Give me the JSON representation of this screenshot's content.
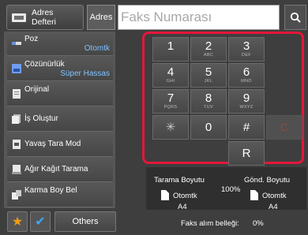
{
  "header": {
    "address_book_label_line1": "Adres",
    "address_book_label_line2": "Defteri",
    "address_label": "Adres",
    "fax_placeholder": "Faks Numarası",
    "search_icon": "search-icon"
  },
  "menu": {
    "items": [
      {
        "label": "Poz",
        "value": "Otomtk",
        "icon": "exposure-icon"
      },
      {
        "label": "Çözünürlük",
        "value": "Süper Hassas",
        "icon": "resolution-icon"
      },
      {
        "label": "Orijinal",
        "value": "",
        "icon": "original-icon"
      },
      {
        "label": "İş Oluştur",
        "value": "",
        "icon": "job-build-icon"
      },
      {
        "label": "Yavaş Tara Mod",
        "value": "",
        "icon": "slow-scan-icon"
      },
      {
        "label": "Ağır Kağıt Tarama",
        "value": "",
        "icon": "thick-paper-icon"
      },
      {
        "label": "Karma Boy Bel",
        "value": "",
        "icon": "mixed-size-icon"
      }
    ],
    "others_label": "Others"
  },
  "keypad": {
    "keys": [
      {
        "digit": "1",
        "sub": ""
      },
      {
        "digit": "2",
        "sub": "ABC"
      },
      {
        "digit": "3",
        "sub": "DEF"
      },
      {
        "digit": "4",
        "sub": "GHI"
      },
      {
        "digit": "5",
        "sub": "JKL"
      },
      {
        "digit": "6",
        "sub": "MNO"
      },
      {
        "digit": "7",
        "sub": "PQRS"
      },
      {
        "digit": "8",
        "sub": "TUV"
      },
      {
        "digit": "9",
        "sub": "WXYZ"
      }
    ],
    "star": "✳",
    "zero": "0",
    "hash": "#",
    "clear": "C",
    "redial": "R"
  },
  "info": {
    "scan_size_label": "Tarama Boyutu",
    "send_size_label": "Gönd. Boyutu",
    "scan_size_value": "Otomtk",
    "send_size_value": "Otomtk",
    "ratio": "100%",
    "scan_paper": "A4",
    "send_paper": "A4",
    "fax_memory_label": "Faks alım belleği:",
    "fax_memory_value": "0%"
  },
  "colors": {
    "highlight": "#e3173a",
    "value_text": "#7fc2ff",
    "star": "#f39c12",
    "check": "#3aa6ff"
  }
}
